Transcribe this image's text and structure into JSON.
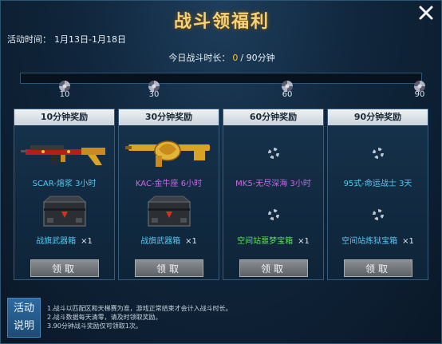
{
  "title": "战斗领福利",
  "close_label": "X",
  "activity": {
    "label": "活动时间：",
    "range": "1月13日-1月18日"
  },
  "today": {
    "label": "今日战斗时长：",
    "current": "0",
    "separator": "/",
    "total": "90分钟"
  },
  "progress": {
    "fraction": 0
  },
  "ticks": [
    "10",
    "30",
    "60",
    "90"
  ],
  "cards": [
    {
      "header": "10分钟奖励",
      "weapon": "SCAR-熔浆 3小时",
      "weapon_color": "#56c8f0",
      "box": "战旗武器箱",
      "box_color": "#56c8f0",
      "qty": "×1",
      "button": "领取"
    },
    {
      "header": "30分钟奖励",
      "weapon": "KAC-金牛座 6小时",
      "weapon_color": "#c96ae6",
      "box": "战旗武器箱",
      "box_color": "#56c8f0",
      "qty": "×1",
      "button": "领取"
    },
    {
      "header": "60分钟奖励",
      "weapon": "MK5-无尽深海 3小时",
      "weapon_color": "#c96ae6",
      "box": "空间站噩梦宝箱",
      "box_color": "#5fe05a",
      "qty": "×1",
      "button": "领取"
    },
    {
      "header": "90分钟奖励",
      "weapon": "95式-命运战士 3天",
      "weapon_color": "#56c8f0",
      "box": "空间站炼狱宝箱",
      "box_color": "#56c8f0",
      "qty": "×1",
      "button": "领取"
    }
  ],
  "explain": {
    "line1": "活动",
    "line2": "说明"
  },
  "rules": [
    "1.战斗以匹配区和天梯赛为准，游戏正常结束才会计入战斗时长。",
    "2.战斗数据每天清零，请及时领取奖励。",
    "3.90分钟战斗奖励仅可领取1次。"
  ]
}
